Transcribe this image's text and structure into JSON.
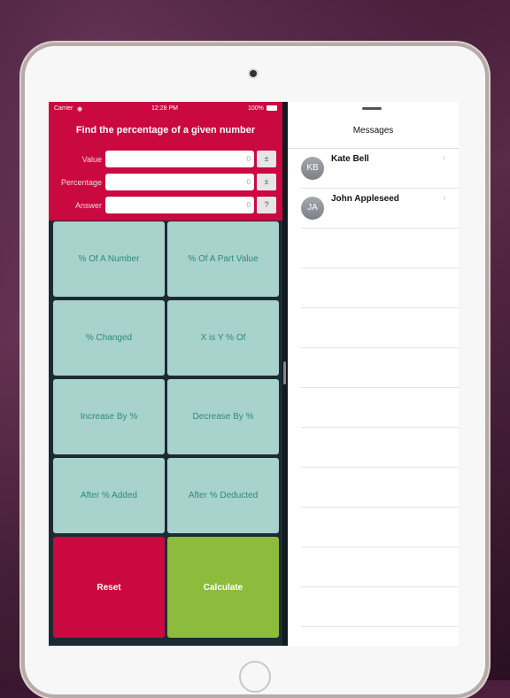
{
  "status_bar": {
    "carrier": "Carrier",
    "time": "12:28 PM",
    "battery": "100%"
  },
  "calculator": {
    "title": "Find the percentage of a given number",
    "fields": [
      {
        "label": "Value",
        "placeholder": "0",
        "button": "±"
      },
      {
        "label": "Percentage",
        "placeholder": "0",
        "button": "±"
      },
      {
        "label": "Answer",
        "placeholder": "0",
        "button": "?"
      }
    ],
    "modes": [
      "% Of A Number",
      "% Of A Part Value",
      "% Changed",
      "X is Y % Of",
      "Increase By %",
      "Decrease By %",
      "After % Added",
      "After % Deducted"
    ],
    "reset_label": "Reset",
    "calculate_label": "Calculate",
    "colors": {
      "header": "#c9093f",
      "mode_button": "#a8d2cc",
      "reset": "#c9093f",
      "calculate": "#8dbb3c"
    }
  },
  "messages": {
    "title": "Messages",
    "contacts": [
      {
        "initials": "KB",
        "name": "Kate Bell"
      },
      {
        "initials": "JA",
        "name": "John Appleseed"
      }
    ]
  }
}
